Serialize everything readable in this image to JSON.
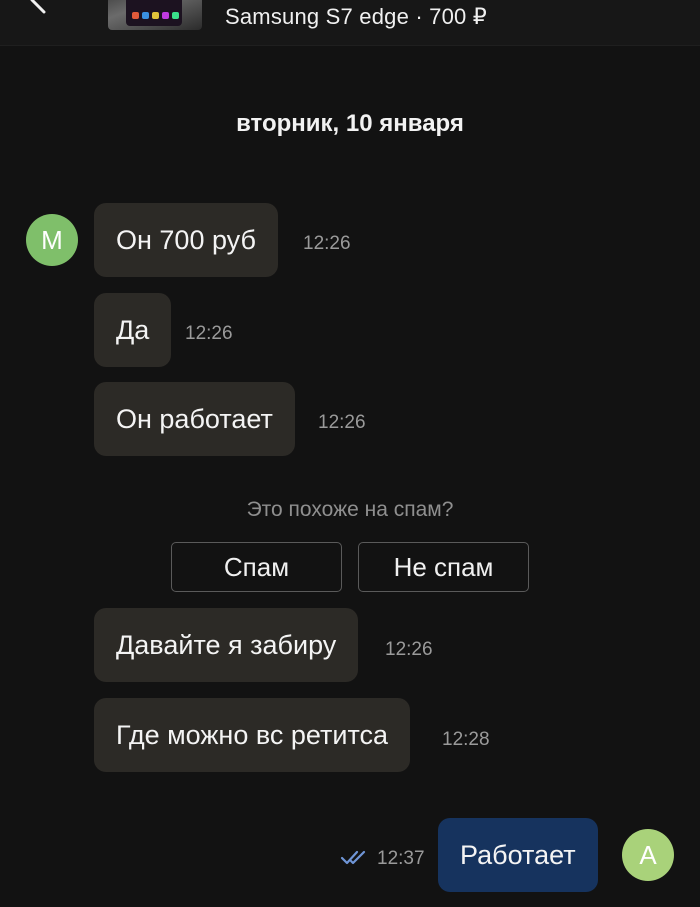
{
  "header": {
    "item_title": "Samsung S7 edge · 700 ₽",
    "back_icon": "chevron-left-icon",
    "thumbnail": "product-photo"
  },
  "date_separator": "вторник, 10 января",
  "contact": {
    "avatar_letter": "M",
    "avatar_color": "#7fbf6a"
  },
  "me": {
    "avatar_letter": "A",
    "avatar_color": "#a9d27a"
  },
  "messages": [
    {
      "text": "Он 700 руб",
      "time": "12:26",
      "direction": "incoming"
    },
    {
      "text": "Да",
      "time": "12:26",
      "direction": "incoming"
    },
    {
      "text": "Он работает",
      "time": "12:26",
      "direction": "incoming"
    },
    {
      "text": "Давайте я забиру",
      "time": "12:26",
      "direction": "incoming"
    },
    {
      "text": "Где можно вс ретитса",
      "time": "12:28",
      "direction": "incoming"
    },
    {
      "text": "Работает",
      "time": "12:37",
      "direction": "outgoing",
      "status": "read"
    }
  ],
  "spam_prompt": {
    "question": "Это похоже на спам?",
    "spam_label": "Спам",
    "not_spam_label": "Не спам"
  },
  "colors": {
    "background": "#121212",
    "incoming_bubble": "#2c2a26",
    "outgoing_bubble": "#16335e",
    "read_check": "#6f95d6"
  }
}
